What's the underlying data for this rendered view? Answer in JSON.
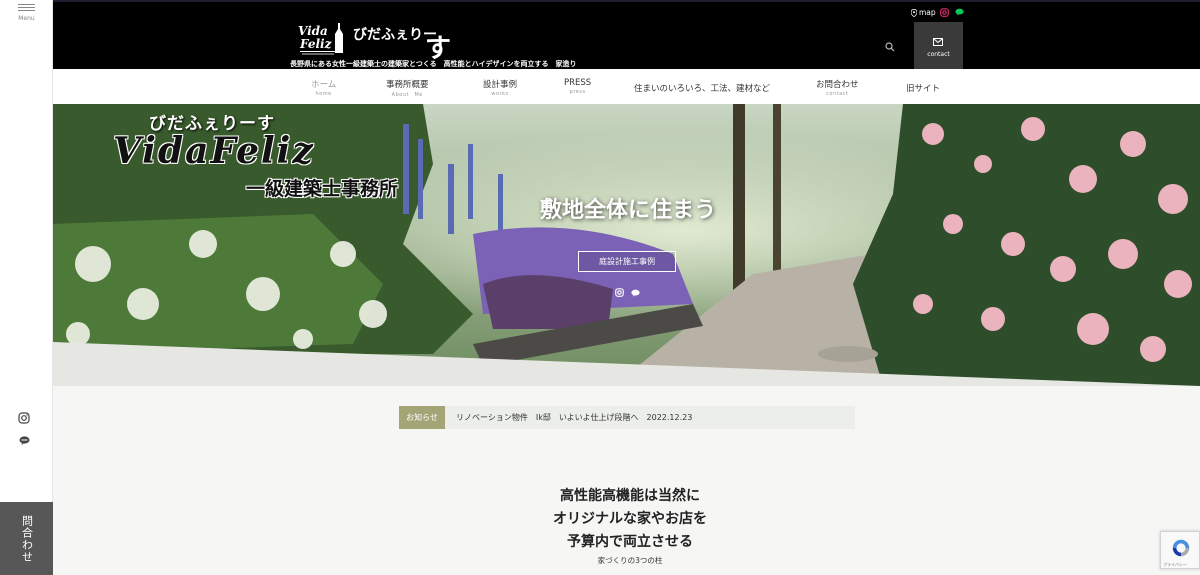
{
  "sidebar": {
    "menu_label": "Menu",
    "inquiry_label": "問合わせ"
  },
  "header": {
    "logo_name": "びだふぇりー",
    "logo_name_big": "す",
    "tagline": "長野県にある女性一級建築士の建築家とつくる　高性能とハイデザインを両立する　家造り",
    "map_label": "map",
    "contact_label": "contact"
  },
  "nav": {
    "items": [
      {
        "jp": "ホーム",
        "en": "home"
      },
      {
        "jp": "事務所概要",
        "en": "About　Me"
      },
      {
        "jp": "設計事例",
        "en": "works"
      },
      {
        "jp": "PRESS",
        "en": "press"
      },
      {
        "jp": "住まいのいろいろ、工法、建材など",
        "en": ""
      },
      {
        "jp": "お問合わせ",
        "en": "contact"
      },
      {
        "jp": "旧サイト",
        "en": ""
      }
    ]
  },
  "hero": {
    "brand_line1": "びだふぇりーす",
    "brand_line2": "VidaFeliz",
    "brand_line3": "一級建築士事務所",
    "title": "敷地全体に住まう",
    "button_label": "庭設計施工事例"
  },
  "news": {
    "badge": "お知らせ",
    "text": "リノベーション物件　Ik邸　いよいよ仕上げ段階へ　2022.12.23"
  },
  "intro": {
    "lines": [
      "高性能高機能は当然に",
      "オリジナルな家やお店を",
      "予算内で両立させる"
    ],
    "sub": "家づくりの3つの柱"
  },
  "recaptcha": {
    "text": "プライバシー"
  },
  "colors": {
    "header_bg": "#000000",
    "news_badge": "#a4a576",
    "inquiry_bg": "#575757",
    "contact_bg": "#3a3a3a"
  }
}
